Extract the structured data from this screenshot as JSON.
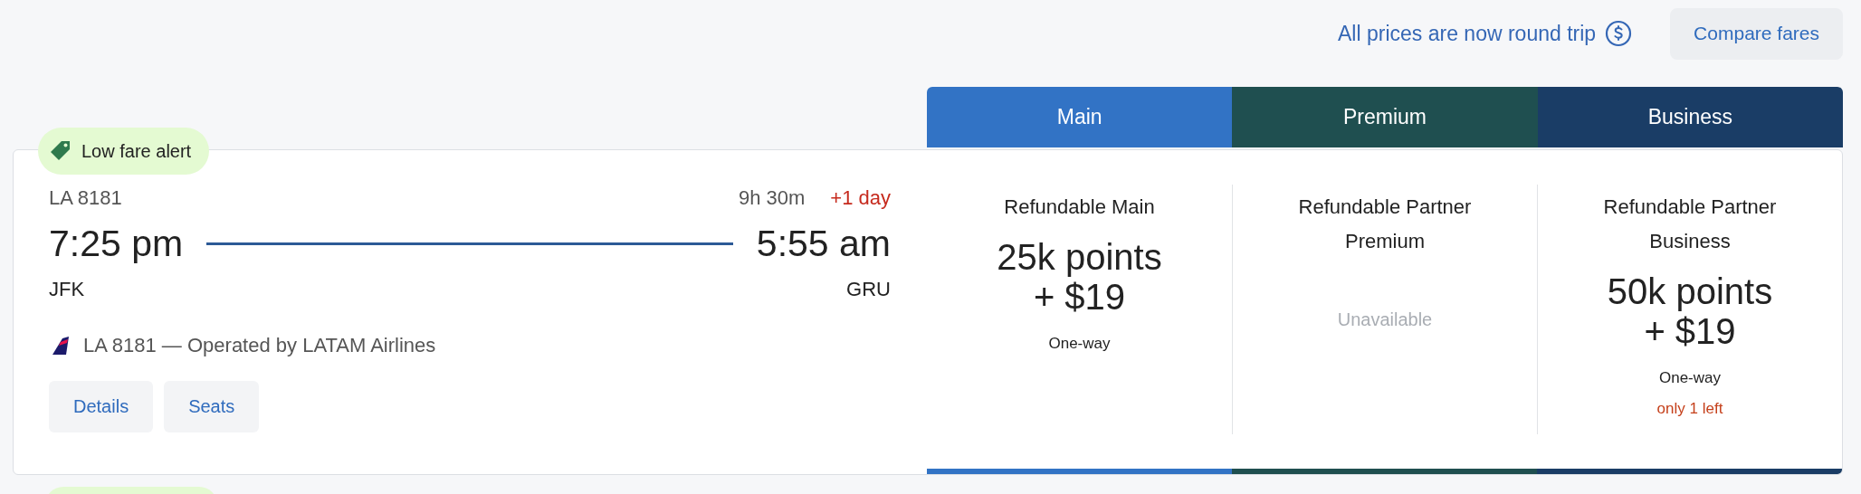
{
  "header": {
    "notice": "All prices are now round trip",
    "compare_button": "Compare fares"
  },
  "cabins": [
    {
      "label": "Main",
      "color": "#3273c5"
    },
    {
      "label": "Premium",
      "color": "#1f4f50"
    },
    {
      "label": "Business",
      "color": "#1a3d66"
    }
  ],
  "flight": {
    "badge": "Low fare alert",
    "flight_number": "LA 8181",
    "duration": "9h 30m",
    "day_offset": "+1 day",
    "depart_time": "7:25 pm",
    "arrive_time": "5:55 am",
    "origin": "JFK",
    "destination": "GRU",
    "operator": "LA 8181 — Operated by LATAM Airlines",
    "buttons": [
      "Details",
      "Seats"
    ]
  },
  "fares": [
    {
      "name": "Refundable Main",
      "kind": "available",
      "price": "25k points",
      "fee": "+ $19",
      "note": "One-way"
    },
    {
      "name": "Refundable Partner Premium",
      "kind": "unavailable",
      "status": "Unavailable"
    },
    {
      "name": "Refundable Partner Business",
      "kind": "available",
      "price": "50k points",
      "fee": "+ $19",
      "note": "One-way",
      "alert": "only 1 left"
    }
  ]
}
